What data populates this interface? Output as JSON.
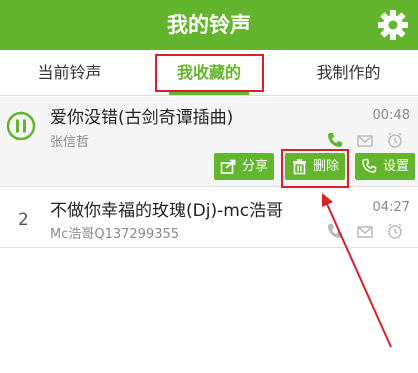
{
  "header": {
    "title": "我的铃声",
    "settings_icon": "gear-icon"
  },
  "tabs": [
    {
      "label": "当前铃声",
      "active": false
    },
    {
      "label": "我收藏的",
      "active": true
    },
    {
      "label": "我制作的",
      "active": false
    }
  ],
  "songs": [
    {
      "index": "",
      "title": "爱你没错(古剑奇谭插曲)",
      "artist": "张信哲",
      "duration": "00:48",
      "state": "playing"
    },
    {
      "index": "2",
      "title": "不做你幸福的玫瑰(Dj)-mc浩哥",
      "artist": "Mc浩哥Q137299355",
      "duration": "04:27",
      "state": "idle"
    }
  ],
  "actions": {
    "share": "分享",
    "delete": "删除",
    "set": "设置"
  },
  "colors": {
    "accent": "#62b52c",
    "highlight": "#d8202b",
    "background": "#ffffff"
  }
}
